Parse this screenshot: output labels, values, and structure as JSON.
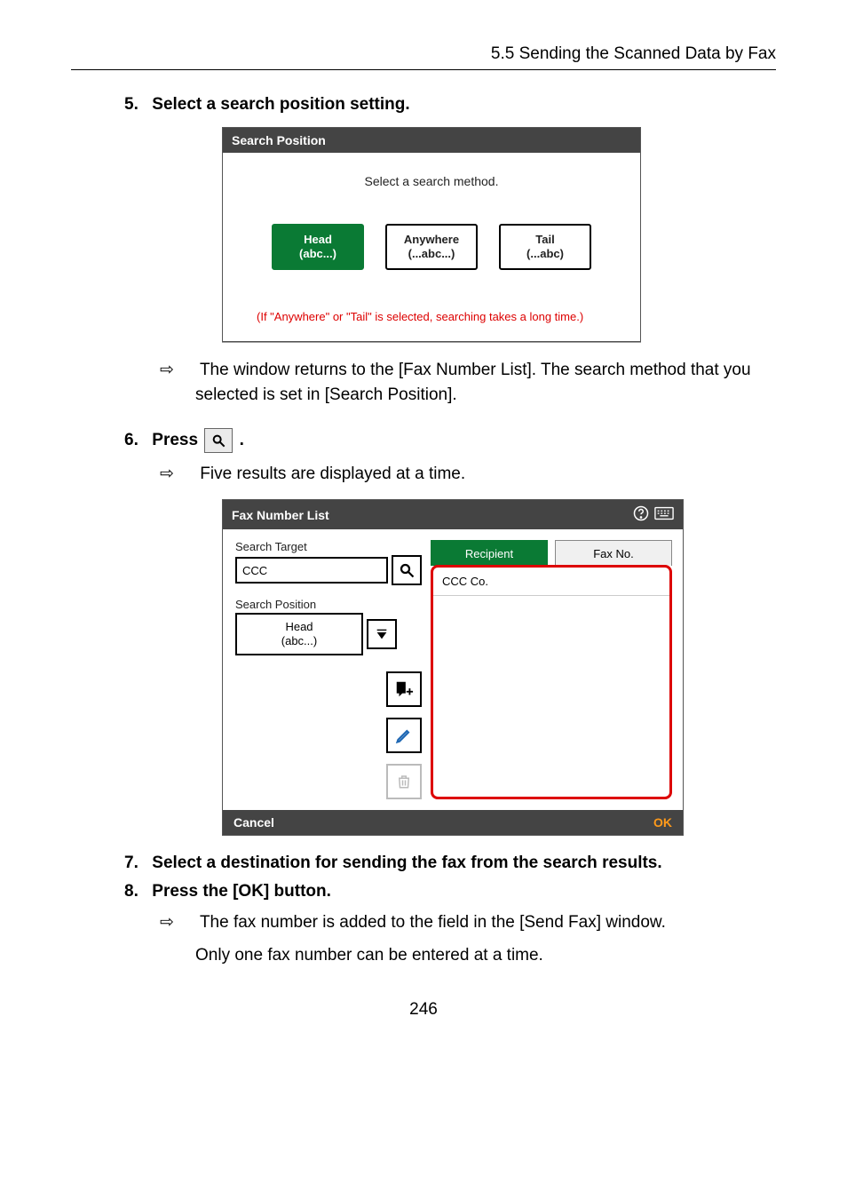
{
  "header": {
    "section": "5.5 Sending the Scanned Data by Fax"
  },
  "step5": {
    "number": "5.",
    "text": "Select a search position setting."
  },
  "searchPositionDialog": {
    "title": "Search Position",
    "prompt": "Select a search method.",
    "buttons": {
      "head": {
        "line1": "Head",
        "line2": "(abc...)"
      },
      "anywhere": {
        "line1": "Anywhere",
        "line2": "(...abc...)"
      },
      "tail": {
        "line1": "Tail",
        "line2": "(...abc)"
      }
    },
    "note": "(If \"Anywhere\" or \"Tail\" is selected, searching takes a long time.)"
  },
  "step5result": {
    "arrow": "⇨",
    "text": "The window returns to the [Fax Number List]. The search method that you selected is set in [Search Position]."
  },
  "step6": {
    "number": "6.",
    "textBefore": "Press ",
    "textAfter": "."
  },
  "step6result": {
    "arrow": "⇨",
    "text": "Five results are displayed at a time."
  },
  "faxNumberList": {
    "title": "Fax Number List",
    "left": {
      "searchTargetLabel": "Search Target",
      "searchTargetValue": "CCC",
      "searchPositionLabel": "Search Position",
      "searchPositionValue": {
        "line1": "Head",
        "line2": "(abc...)"
      }
    },
    "tabs": {
      "recipient": "Recipient",
      "faxno": "Fax No."
    },
    "results": [
      "CCC Co."
    ],
    "footer": {
      "cancel": "Cancel",
      "ok": "OK"
    }
  },
  "step7": {
    "number": "7.",
    "text": "Select a destination for sending the fax from the search results."
  },
  "step8": {
    "number": "8.",
    "text": "Press the [OK] button.",
    "result": {
      "arrow": "⇨",
      "line1": "The fax number is added to the field in the [Send Fax] window.",
      "line2": "Only one fax number can be entered at a time."
    }
  },
  "pageNumber": "246"
}
